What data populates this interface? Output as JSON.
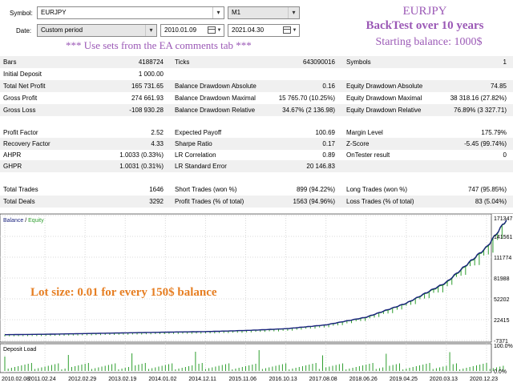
{
  "header": {
    "symbol_label": "Symbol:",
    "symbol_value": "EURJPY",
    "timeframe_value": "M1",
    "date_label": "Date:",
    "period_value": "Custom period",
    "date_from": "2010.01.09",
    "date_to": "2021.04.30",
    "note": "*** Use sets from the EA comments tab ***"
  },
  "promo": {
    "pair": "EURJPY",
    "backtest": "BackTest over 10 years",
    "balance": "Starting balance: 1000$"
  },
  "stats": {
    "bars_label": "Bars",
    "bars_value": "4188724",
    "ticks_label": "Ticks",
    "ticks_value": "643090016",
    "symbols_label": "Symbols",
    "symbols_value": "1",
    "initial_deposit_label": "Initial Deposit",
    "initial_deposit_value": "1 000.00",
    "total_net_profit_label": "Total Net Profit",
    "total_net_profit_value": "165 731.65",
    "bal_dd_abs_label": "Balance Drawdown Absolute",
    "bal_dd_abs_value": "0.16",
    "eq_dd_abs_label": "Equity Drawdown Absolute",
    "eq_dd_abs_value": "74.85",
    "gross_profit_label": "Gross Profit",
    "gross_profit_value": "274 661.93",
    "bal_dd_max_label": "Balance Drawdown Maximal",
    "bal_dd_max_value": "15 765.70 (10.25%)",
    "eq_dd_max_label": "Equity Drawdown Maximal",
    "eq_dd_max_value": "38 318.16 (27.82%)",
    "gross_loss_label": "Gross Loss",
    "gross_loss_value": "-108 930.28",
    "bal_dd_rel_label": "Balance Drawdown Relative",
    "bal_dd_rel_value": "34.67% (2 136.98)",
    "eq_dd_rel_label": "Equity Drawdown Relative",
    "eq_dd_rel_value": "76.89% (3 327.71)",
    "profit_factor_label": "Profit Factor",
    "profit_factor_value": "2.52",
    "expected_payoff_label": "Expected Payoff",
    "expected_payoff_value": "100.69",
    "margin_level_label": "Margin Level",
    "margin_level_value": "175.79%",
    "recovery_factor_label": "Recovery Factor",
    "recovery_factor_value": "4.33",
    "sharpe_label": "Sharpe Ratio",
    "sharpe_value": "0.17",
    "zscore_label": "Z-Score",
    "zscore_value": "-5.45 (99.74%)",
    "ahpr_label": "AHPR",
    "ahpr_value": "1.0033 (0.33%)",
    "lr_corr_label": "LR Correlation",
    "lr_corr_value": "0.89",
    "ontester_label": "OnTester result",
    "ontester_value": "0",
    "ghpr_label": "GHPR",
    "ghpr_value": "1.0031 (0.31%)",
    "lr_std_label": "LR Standard Error",
    "lr_std_value": "20 146.83",
    "total_trades_label": "Total Trades",
    "total_trades_value": "1646",
    "short_trades_label": "Short Trades (won %)",
    "short_trades_value": "899 (94.22%)",
    "long_trades_label": "Long Trades (won %)",
    "long_trades_value": "747 (95.85%)",
    "total_deals_label": "Total Deals",
    "total_deals_value": "3292",
    "profit_trades_label": "Profit Trades (% of total)",
    "profit_trades_value": "1563 (94.96%)",
    "loss_trades_label": "Loss Trades (% of total)",
    "loss_trades_value": "83 (5.04%)"
  },
  "chart": {
    "legend_balance": "Balance",
    "legend_sep": " / ",
    "legend_equity": "Equity",
    "overlay_text": "Lot size: 0.01 for every 150$ balance",
    "deposit_load_label": "Deposit Load",
    "colors": {
      "balance": "#1a237e",
      "equity": "#2e9e2e",
      "overlay": "#e67e22",
      "load": "#2e9e2e"
    }
  },
  "chart_data": {
    "type": "line",
    "y_ticks": [
      "171347",
      "141561",
      "111774",
      "81988",
      "52202",
      "22415",
      "-7371"
    ],
    "y_tick_values": [
      171347,
      141561,
      111774,
      81988,
      52202,
      22415,
      -7371
    ],
    "load_ticks": [
      "100.0%",
      "0.0%"
    ],
    "load_tick_values": [
      100,
      0
    ],
    "x_ticks": [
      "2010.02.08",
      "2011.02.24",
      "2012.02.29",
      "2013.02.19",
      "2014.01.02",
      "2014.12.11",
      "2015.11.06",
      "2016.10.13",
      "2017.08.08",
      "2018.06.26",
      "2019.04.25",
      "2020.03.13",
      "2020.12.23"
    ],
    "series": [
      {
        "name": "Balance",
        "x": [
          0,
          1,
          2,
          3,
          4,
          5,
          6,
          7,
          8,
          9,
          10,
          11,
          12,
          12.5
        ],
        "values": [
          1000,
          1600,
          2600,
          3600,
          4600,
          5400,
          7000,
          9500,
          15000,
          26000,
          46000,
          76000,
          126000,
          165700
        ]
      },
      {
        "name": "Equity",
        "x": [
          0,
          1,
          2,
          3,
          4,
          5,
          6,
          7,
          8,
          9,
          10,
          11,
          12,
          12.5
        ],
        "values": [
          1000,
          1500,
          2500,
          3500,
          4500,
          5300,
          6800,
          9300,
          14800,
          25500,
          45500,
          75000,
          125000,
          165000
        ]
      }
    ],
    "ylim": [
      -7371,
      171347
    ]
  }
}
